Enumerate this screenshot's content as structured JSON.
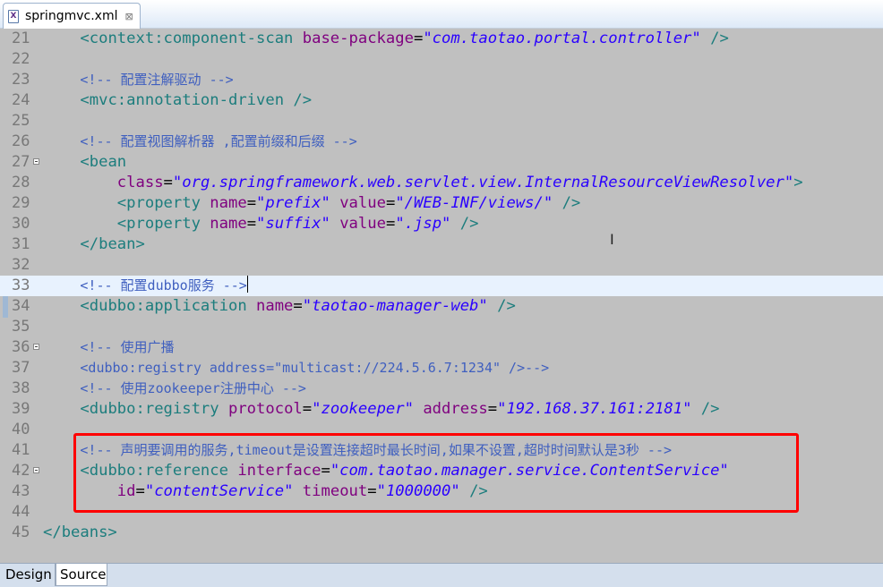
{
  "tabbar": {
    "file_tab_label": "springmvc.xml",
    "file_icon": "xml-file-icon",
    "close_symbol": "⊠"
  },
  "editor": {
    "lines": [
      {
        "num": "21",
        "segments": [
          [
            "plain",
            "    "
          ],
          [
            "tag",
            "<context:component-scan "
          ],
          [
            "attr",
            "base-package"
          ],
          [
            "plain",
            "="
          ],
          [
            "val",
            "\"com.taotao.portal.controller\""
          ],
          [
            "tag",
            " />"
          ]
        ]
      },
      {
        "num": "22",
        "segments": []
      },
      {
        "num": "23",
        "segments": [
          [
            "plain",
            "    "
          ],
          [
            "comment",
            "<!-- 配置注解驱动 -->"
          ]
        ]
      },
      {
        "num": "24",
        "segments": [
          [
            "plain",
            "    "
          ],
          [
            "tag",
            "<mvc:annotation-driven />"
          ]
        ]
      },
      {
        "num": "25",
        "segments": []
      },
      {
        "num": "26",
        "segments": [
          [
            "plain",
            "    "
          ],
          [
            "comment",
            "<!-- 配置视图解析器 ,配置前缀和后缀 -->"
          ]
        ]
      },
      {
        "num": "27",
        "fold": true,
        "segments": [
          [
            "plain",
            "    "
          ],
          [
            "tag",
            "<bean"
          ]
        ]
      },
      {
        "num": "28",
        "segments": [
          [
            "plain",
            "        "
          ],
          [
            "attr",
            "class"
          ],
          [
            "plain",
            "="
          ],
          [
            "val",
            "\"org.springframework.web.servlet.view.InternalResourceViewResolver\""
          ],
          [
            "tag",
            ">"
          ]
        ]
      },
      {
        "num": "29",
        "segments": [
          [
            "plain",
            "        "
          ],
          [
            "tag",
            "<property "
          ],
          [
            "attr",
            "name"
          ],
          [
            "plain",
            "="
          ],
          [
            "val",
            "\"prefix\""
          ],
          [
            "plain",
            " "
          ],
          [
            "attr",
            "value"
          ],
          [
            "plain",
            "="
          ],
          [
            "val",
            "\"/WEB-INF/views/\""
          ],
          [
            "tag",
            " />"
          ]
        ]
      },
      {
        "num": "30",
        "segments": [
          [
            "plain",
            "        "
          ],
          [
            "tag",
            "<property "
          ],
          [
            "attr",
            "name"
          ],
          [
            "plain",
            "="
          ],
          [
            "val",
            "\"suffix\""
          ],
          [
            "plain",
            " "
          ],
          [
            "attr",
            "value"
          ],
          [
            "plain",
            "="
          ],
          [
            "val",
            "\".jsp\""
          ],
          [
            "tag",
            " />"
          ]
        ]
      },
      {
        "num": "31",
        "segments": [
          [
            "plain",
            "    "
          ],
          [
            "tag",
            "</bean>"
          ]
        ]
      },
      {
        "num": "32",
        "segments": []
      },
      {
        "num": "33",
        "current": true,
        "segments": [
          [
            "plain",
            "    "
          ],
          [
            "comment",
            "<!-- 配置dubbo服务 -->"
          ],
          [
            "cursor",
            ""
          ]
        ]
      },
      {
        "num": "34",
        "segments": [
          [
            "plain",
            "    "
          ],
          [
            "tag",
            "<dubbo:application "
          ],
          [
            "attr",
            "name"
          ],
          [
            "plain",
            "="
          ],
          [
            "val",
            "\"taotao-manager-web\""
          ],
          [
            "tag",
            " />"
          ]
        ]
      },
      {
        "num": "35",
        "segments": []
      },
      {
        "num": "36",
        "fold": true,
        "segments": [
          [
            "plain",
            "    "
          ],
          [
            "comment",
            "<!-- 使用广播"
          ]
        ]
      },
      {
        "num": "37",
        "segments": [
          [
            "plain",
            "    "
          ],
          [
            "comment",
            "<dubbo:registry address=\"multicast://224.5.6.7:1234\" />-->"
          ]
        ]
      },
      {
        "num": "38",
        "segments": [
          [
            "plain",
            "    "
          ],
          [
            "comment",
            "<!-- 使用zookeeper注册中心 -->"
          ]
        ]
      },
      {
        "num": "39",
        "segments": [
          [
            "plain",
            "    "
          ],
          [
            "tag",
            "<dubbo:registry "
          ],
          [
            "attr",
            "protocol"
          ],
          [
            "plain",
            "="
          ],
          [
            "val",
            "\"zookeeper\""
          ],
          [
            "plain",
            " "
          ],
          [
            "attr",
            "address"
          ],
          [
            "plain",
            "="
          ],
          [
            "val",
            "\"192.168.37.161:2181\""
          ],
          [
            "tag",
            " />"
          ]
        ]
      },
      {
        "num": "40",
        "segments": []
      },
      {
        "num": "41",
        "segments": [
          [
            "plain",
            "    "
          ],
          [
            "comment",
            "<!-- 声明要调用的服务,timeout是设置连接超时最长时间,如果不设置,超时时间默认是3秒 -->"
          ]
        ]
      },
      {
        "num": "42",
        "fold": true,
        "segments": [
          [
            "plain",
            "    "
          ],
          [
            "tag",
            "<dubbo:reference "
          ],
          [
            "attr",
            "interface"
          ],
          [
            "plain",
            "="
          ],
          [
            "val",
            "\"com.taotao.manager.service.ContentService\""
          ]
        ]
      },
      {
        "num": "43",
        "segments": [
          [
            "plain",
            "        "
          ],
          [
            "attr",
            "id"
          ],
          [
            "plain",
            "="
          ],
          [
            "val",
            "\"contentService\""
          ],
          [
            "plain",
            " "
          ],
          [
            "attr",
            "timeout"
          ],
          [
            "plain",
            "="
          ],
          [
            "val",
            "\"1000000\""
          ],
          [
            "tag",
            " />"
          ]
        ]
      },
      {
        "num": "44",
        "segments": []
      },
      {
        "num": "45",
        "segments": [
          [
            "tag",
            "</beans>"
          ]
        ]
      }
    ]
  },
  "bottom_tabs": {
    "design": "Design",
    "source": "Source"
  },
  "colors": {
    "editor_bg": "#c0c0c0",
    "tag": "#1c7d7d",
    "attribute": "#7f007f",
    "value": "#2a00ff",
    "comment": "#3f5fbf",
    "highlight_box": "#ff0000"
  }
}
